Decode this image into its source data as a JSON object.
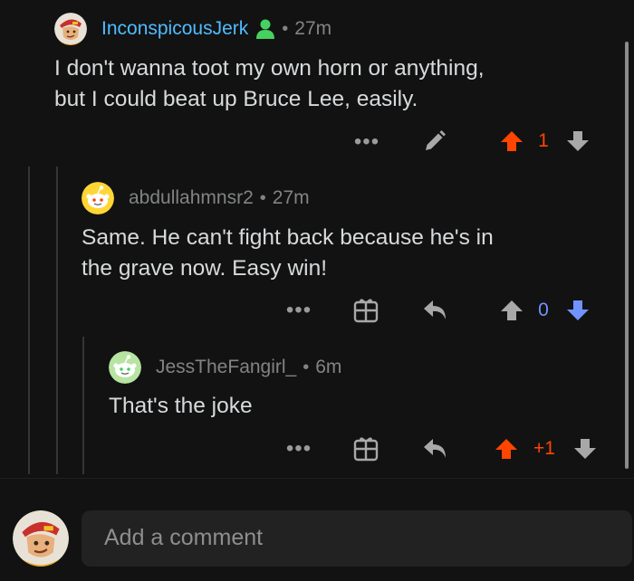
{
  "comments": [
    {
      "username": "InconspicousJerk",
      "separator": "•",
      "time": "27m",
      "text_lines": [
        "I don't wanna toot my own horn or anything,",
        "but I could beat up Bruce Lee, easily."
      ],
      "more": "•••",
      "vote_count": "1",
      "vote_state": "upvoted",
      "username_color": "#4fbcff",
      "vote_color": "#ff4500"
    },
    {
      "username": "abdullahmnsr2",
      "separator": "•",
      "time": "27m",
      "text_lines": [
        "Same. He can't fight back because he's in",
        "the grave now. Easy win!"
      ],
      "more": "•••",
      "vote_count": "0",
      "vote_state": "downvoted",
      "username_color": "#818384",
      "vote_color": "#7193ff"
    },
    {
      "username": "JessTheFangirl_",
      "separator": "•",
      "time": "6m",
      "text_lines": [
        "That's the joke"
      ],
      "more": "•••",
      "vote_count": "+1",
      "vote_state": "upvoted",
      "username_color": "#818384",
      "vote_color": "#ff4500"
    }
  ],
  "composer": {
    "placeholder": "Add a comment"
  },
  "icons": [
    "avatar",
    "op-person-icon",
    "edit-pencil-icon",
    "upvote-arrow-icon",
    "downvote-arrow-icon",
    "award-gift-icon",
    "reply-arrow-icon"
  ]
}
